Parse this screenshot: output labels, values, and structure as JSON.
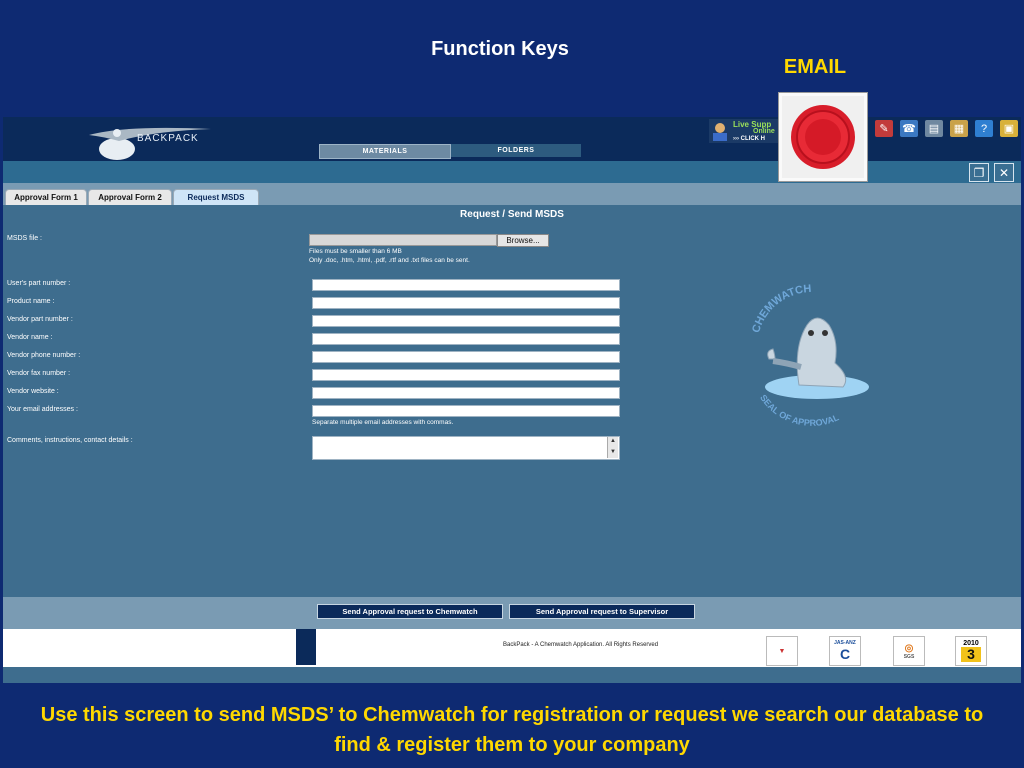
{
  "slide": {
    "title": "Function Keys",
    "email_label": "EMAIL",
    "caption": "Use this screen to send MSDS’ to Chemwatch for registration or request we search our database to find & register them to your company"
  },
  "app": {
    "logo_text": "BACKPACK",
    "nav_tabs": [
      "MATERIALS",
      "FOLDERS"
    ],
    "live_support": {
      "line1": "Live Supp",
      "line2": "Online",
      "line3": "››› CLICK H"
    },
    "form_tabs": [
      "Approval Form 1",
      "Approval Form 2",
      "Request MSDS"
    ],
    "form_title": "Request / Send MSDS",
    "msds_label": "MSDS file :",
    "browse_label": "Browse...",
    "file_hint_1": "Files must be smaller than 6 MB",
    "file_hint_2": "Only .doc, .htm, .html, .pdf, .rtf and .txt files can be sent.",
    "fields": [
      "User's part number :",
      "Product name :",
      "Vendor part number :",
      "Vendor name :",
      "Vendor phone number :",
      "Vendor fax number :",
      "Vendor website :",
      "Your email addresses :"
    ],
    "email_hint": "Separate multiple email addresses with commas.",
    "comments_label": "Comments, instructions, contact details :",
    "seal_top": "CHEMWATCH",
    "seal_bottom": "SEAL OF APPROVAL",
    "actions": [
      "Send Approval request to Chemwatch",
      "Send Approval request to Supervisor"
    ],
    "copyright": "BackPack - A Chemwatch Application. All Rights Reserved",
    "cert_year": "2010",
    "cert_num": "3",
    "cert_jas": "JAS-ANZ",
    "cert_sgs": "SGS"
  },
  "colors": {
    "slide_bg": "#0e2a72",
    "title_text": "#ffffff",
    "caption_text": "#ffd800",
    "app_bg": "#3e6d8e",
    "header": "#0b2a5a"
  },
  "icons": [
    "logo-icon",
    "live-support-avatar-icon",
    "email-seal-icon",
    "tool-icon",
    "restore-icon",
    "close-icon",
    "seal-mascot-icon"
  ]
}
